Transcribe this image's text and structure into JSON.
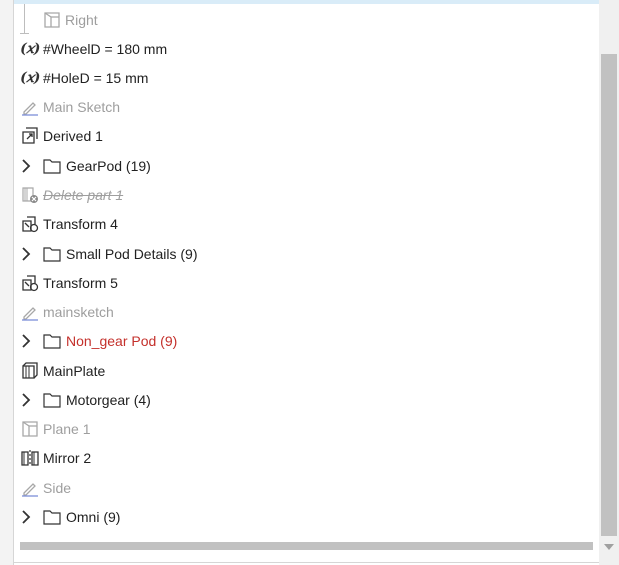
{
  "tree": {
    "items": [
      {
        "label": "Right",
        "icon": "plane-icon",
        "state": "muted"
      },
      {
        "label": "#WheelD = 180 mm",
        "icon": "variable-icon",
        "icon_text": "(𝑥)",
        "state": "normal"
      },
      {
        "label": "#HoleD = 15 mm",
        "icon": "variable-icon",
        "icon_text": "(𝑥)",
        "state": "normal"
      },
      {
        "label": "Main Sketch",
        "icon": "sketch-icon",
        "state": "muted"
      },
      {
        "label": "Derived 1",
        "icon": "derived-icon",
        "state": "normal"
      },
      {
        "label": "GearPod (19)",
        "icon": "folder-icon",
        "state": "normal"
      },
      {
        "label": "Delete part 1",
        "icon": "delete-part-icon",
        "state": "suppressed"
      },
      {
        "label": "Transform 4",
        "icon": "transform-icon",
        "state": "normal"
      },
      {
        "label": "Small Pod Details (9)",
        "icon": "folder-icon",
        "state": "normal"
      },
      {
        "label": "Transform 5",
        "icon": "transform-icon",
        "state": "normal"
      },
      {
        "label": "mainsketch",
        "icon": "sketch-icon",
        "state": "muted"
      },
      {
        "label": "Non_gear Pod (9)",
        "icon": "folder-icon",
        "state": "error"
      },
      {
        "label": "MainPlate",
        "icon": "extrude-icon",
        "state": "normal"
      },
      {
        "label": "Motorgear (4)",
        "icon": "folder-icon",
        "state": "normal"
      },
      {
        "label": "Plane 1",
        "icon": "plane-icon",
        "state": "muted"
      },
      {
        "label": "Mirror 2",
        "icon": "mirror-icon",
        "state": "normal"
      },
      {
        "label": "Side",
        "icon": "sketch-icon",
        "state": "muted"
      },
      {
        "label": "Omni (9)",
        "icon": "folder-icon",
        "state": "normal"
      }
    ]
  },
  "colors": {
    "text": "#212121",
    "muted": "#9e9e9e",
    "error": "#c4302b",
    "highlight": "#d9ecf8",
    "scrollbar": "#c1c1c1"
  }
}
